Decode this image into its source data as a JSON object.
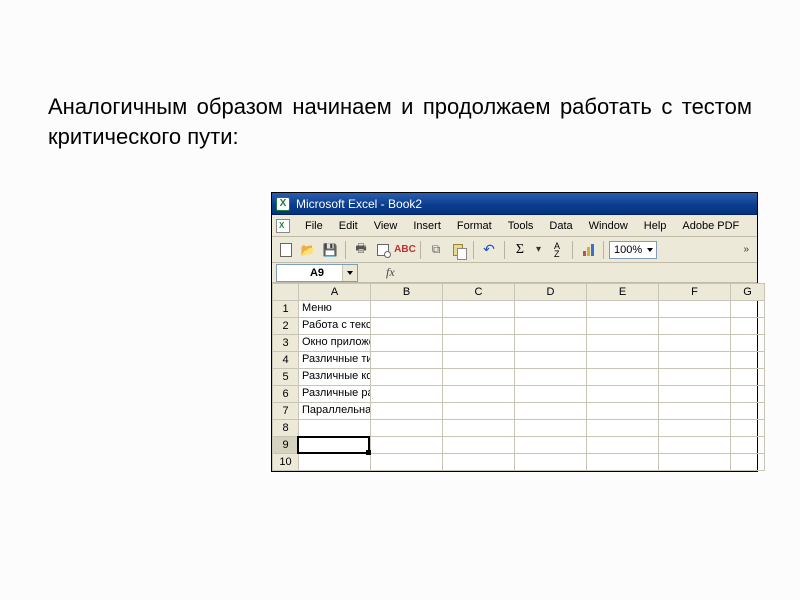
{
  "slide": {
    "text": "Аналогичным образом начинаем и продолжаем работать с тестом критического пути:"
  },
  "titlebar": {
    "title": "Microsoft Excel - Book2"
  },
  "menu": {
    "items": [
      "File",
      "Edit",
      "View",
      "Insert",
      "Format",
      "Tools",
      "Data",
      "Window",
      "Help",
      "Adobe PDF"
    ]
  },
  "toolbar": {
    "zoom": "100%",
    "spell": "ABC"
  },
  "formula_bar": {
    "namebox": "A9",
    "fx_label": "fx"
  },
  "grid": {
    "columns": [
      "A",
      "B",
      "C",
      "D",
      "E",
      "F",
      "G"
    ],
    "row_headers": [
      "1",
      "2",
      "3",
      "4",
      "5",
      "6",
      "7",
      "8",
      "9",
      "10"
    ],
    "selected_row": "9",
    "cells": {
      "A1": "Меню",
      "A2": "Работа с текстом",
      "A3": "Окно приложения",
      "A4": "Различные типы файлов",
      "A5": "Различные кодировки",
      "A6": "Различные размеры файлов",
      "A7": "Параллельная работа нескольких копий приложения"
    }
  }
}
